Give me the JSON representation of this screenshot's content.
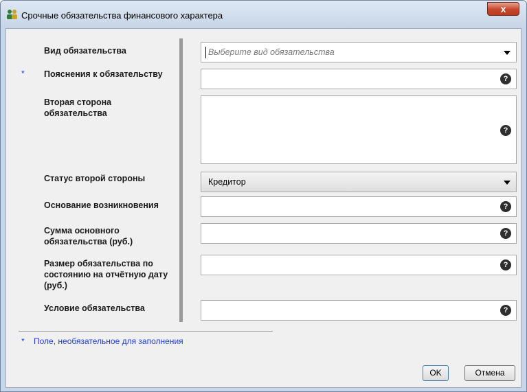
{
  "window": {
    "title": "Срочные обязательства финансового характера",
    "close_label": "x"
  },
  "form": {
    "obligation_type": {
      "label": "Вид обязательства",
      "placeholder": "Выберите вид обязательства"
    },
    "explanation": {
      "label": "Пояснения к обязательству",
      "optional_marker": "*",
      "value": ""
    },
    "counterparty": {
      "label": "Вторая сторона обязательства",
      "value": ""
    },
    "counterparty_status": {
      "label": "Статус второй стороны",
      "value": "Кредитор"
    },
    "basis": {
      "label": "Основание возникновения",
      "value": ""
    },
    "principal_amount": {
      "label": "Сумма основного обязательства (руб.)",
      "value": ""
    },
    "amount_at_report_date": {
      "label": "Размер обязательства по состоянию на отчётную дату (руб.)",
      "value": ""
    },
    "condition": {
      "label": "Условие обязательства",
      "value": ""
    },
    "help_glyph": "?"
  },
  "footnote": {
    "marker": "*",
    "text": "Поле, необязательное для заполнения"
  },
  "buttons": {
    "ok": "OK",
    "cancel": "Отмена"
  },
  "colors": {
    "accent_blue": "#1f3fd6",
    "close_red": "#c6462a"
  }
}
